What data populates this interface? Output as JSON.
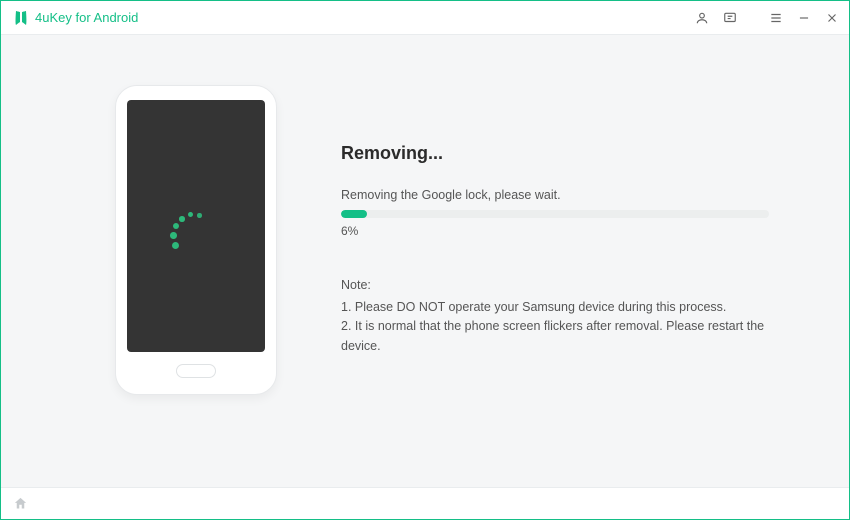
{
  "app": {
    "title": "4uKey for Android"
  },
  "colors": {
    "accent": "#14bf87"
  },
  "progress": {
    "heading": "Removing...",
    "subtext": "Removing the Google lock, please wait.",
    "percent_value": 6,
    "percent_label": "6%"
  },
  "notes": {
    "head": "Note:",
    "line1": "1. Please DO NOT operate your Samsung device during this process.",
    "line2": "2. It is normal that the phone screen flickers after removal. Please restart the device."
  }
}
